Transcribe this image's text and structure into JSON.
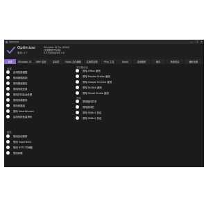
{
  "window": {
    "title": "Optimizer",
    "controls": [
      "—",
      "□",
      "✕"
    ]
  },
  "header": {
    "app_name": "Optimizer",
    "version": "版本: 4.7",
    "sysinfo": [
      "Windows 10 Pro (64bit)",
      "(处理器型号信息)",
      "4.0 Framework 4.8"
    ]
  },
  "tabs": [
    "常规",
    "Windows 10",
    "UWP 应用",
    "启动项",
    "Hosts 文件编辑",
    "注册表清理",
    "Ping 工具",
    "Hosts",
    "应用程序",
    "硬件",
    "系统信息",
    "偏好设置"
  ],
  "sections": {
    "general": {
      "title": "常规",
      "items": [
        "启用性能调整",
        "禁用网络限制",
        "禁用错误报告",
        "禁用系统还原",
        "禁用打印后台处理",
        "禁用传真服务",
        "禁用家庭组",
        "禁用 SmartScreen",
        "启用传统音量滑块"
      ]
    },
    "browsers": {
      "title": "浏览器优化",
      "items": [
        "禁用 Office 遥测",
        "禁用 Mozilla Firefox 遥测",
        "禁用 Google Chrome 遥测",
        "禁用 NVIDIA 遥测",
        "禁用 Visual Studio 遥测"
      ]
    },
    "other": {
      "title": "其他",
      "items": [
        "禁用媒体共享",
        "禁用游戏栏",
        "禁用 SMBv1 协议",
        "禁用 SMBv2 协议"
      ]
    },
    "services": {
      "title": "服务",
      "items": [
        "禁用自动更新",
        "禁用 Superfetch",
        "禁用 NTFS 时间戳",
        "禁用休眠"
      ]
    }
  },
  "colors": {
    "accent": "#8a6cc9",
    "background": "#1b1b1b",
    "text": "#e0e0e0"
  }
}
